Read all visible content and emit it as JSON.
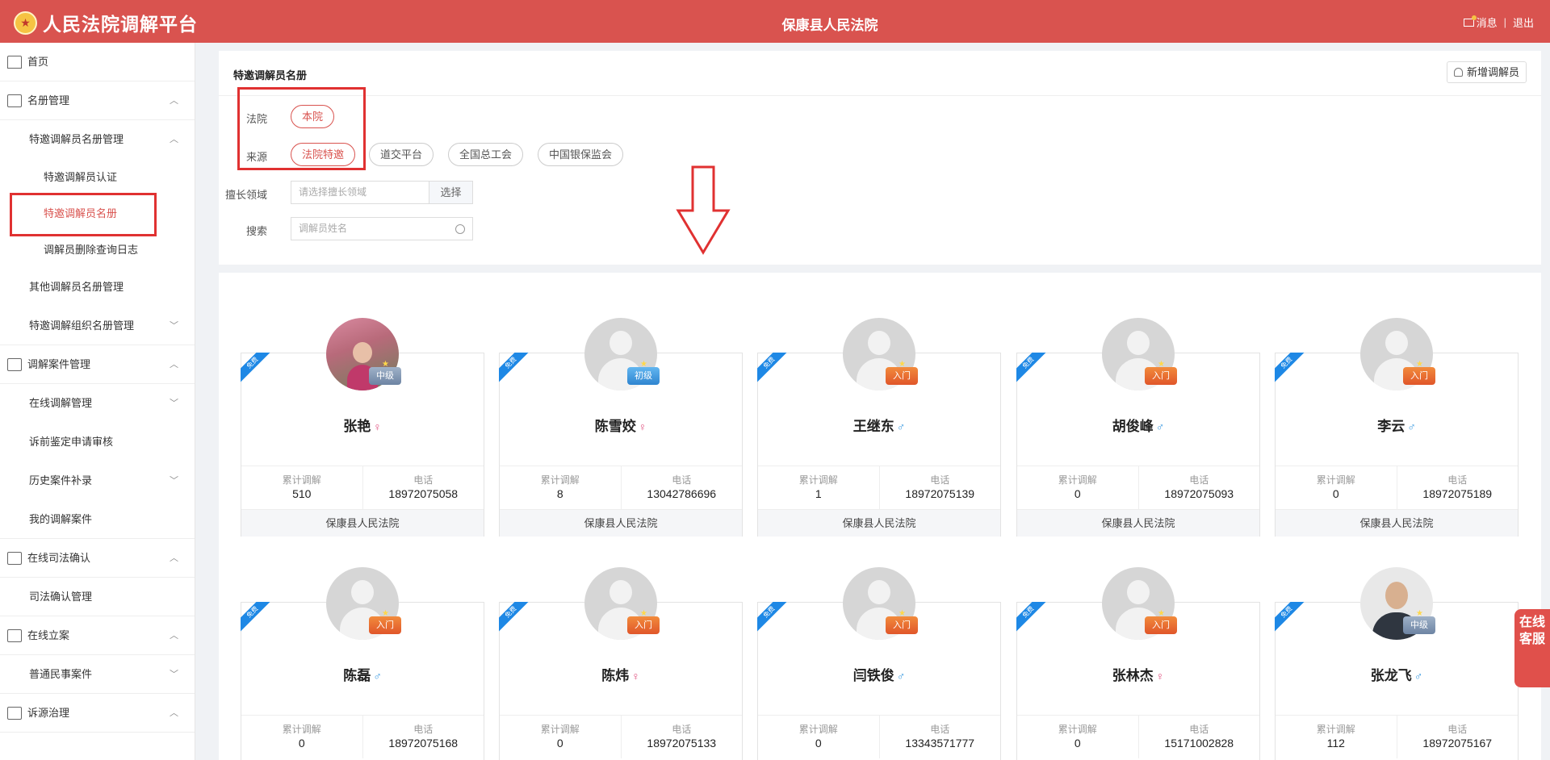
{
  "header": {
    "app_title": "人民法院调解平台",
    "court_name": "保康县人民法院",
    "messages_label": "消息",
    "separator": "|",
    "logout_label": "退出"
  },
  "sidebar": {
    "items": [
      {
        "label": "首页"
      },
      {
        "label": "名册管理"
      },
      {
        "label": "特邀调解员名册管理"
      },
      {
        "label": "特邀调解员认证"
      },
      {
        "label": "特邀调解员名册"
      },
      {
        "label": "调解员删除查询日志"
      },
      {
        "label": "其他调解员名册管理"
      },
      {
        "label": "特邀调解组织名册管理"
      },
      {
        "label": "调解案件管理"
      },
      {
        "label": "在线调解管理"
      },
      {
        "label": "诉前鉴定申请审核"
      },
      {
        "label": "历史案件补录"
      },
      {
        "label": "我的调解案件"
      },
      {
        "label": "在线司法确认"
      },
      {
        "label": "司法确认管理"
      },
      {
        "label": "在线立案"
      },
      {
        "label": "普通民事案件"
      },
      {
        "label": "诉源治理"
      }
    ]
  },
  "filter": {
    "title": "特邀调解员名册",
    "add_button": "新增调解员",
    "court_label": "法院",
    "court_options": [
      "本院"
    ],
    "source_label": "来源",
    "source_options": [
      "法院特邀",
      "道交平台",
      "全国总工会",
      "中国银保监会"
    ],
    "field_label": "擅长领域",
    "field_placeholder": "请选择擅长领域",
    "field_select_button": "选择",
    "search_label": "搜索",
    "search_placeholder": "调解员姓名"
  },
  "card_labels": {
    "ribbon": "免费",
    "cases_label": "累计调解",
    "phone_label": "电话"
  },
  "mediators": [
    {
      "name": "张艳",
      "gender": "♀",
      "level": "中级",
      "cases": "510",
      "phone": "18972075058",
      "court": "保康县人民法院"
    },
    {
      "name": "陈雪姣",
      "gender": "♀",
      "level": "初级",
      "cases": "8",
      "phone": "13042786696",
      "court": "保康县人民法院"
    },
    {
      "name": "王继东",
      "gender": "♂",
      "level": "入门",
      "cases": "1",
      "phone": "18972075139",
      "court": "保康县人民法院"
    },
    {
      "name": "胡俊峰",
      "gender": "♂",
      "level": "入门",
      "cases": "0",
      "phone": "18972075093",
      "court": "保康县人民法院"
    },
    {
      "name": "李云",
      "gender": "♂",
      "level": "入门",
      "cases": "0",
      "phone": "18972075189",
      "court": "保康县人民法院"
    },
    {
      "name": "陈磊",
      "gender": "♂",
      "level": "入门",
      "cases": "0",
      "phone": "18972075168",
      "court": ""
    },
    {
      "name": "陈炜",
      "gender": "♀",
      "level": "入门",
      "cases": "0",
      "phone": "18972075133",
      "court": ""
    },
    {
      "name": "闫铁俊",
      "gender": "♂",
      "level": "入门",
      "cases": "0",
      "phone": "13343571777",
      "court": ""
    },
    {
      "name": "张林杰",
      "gender": "♀",
      "level": "入门",
      "cases": "0",
      "phone": "15171002828",
      "court": ""
    },
    {
      "name": "张龙飞",
      "gender": "♂",
      "level": "中级",
      "cases": "112",
      "phone": "18972075167",
      "court": ""
    }
  ],
  "online_service": "在线客服",
  "colors": {
    "brand": "#d9534f",
    "annotation": "#e03131",
    "ribbon": "#1e88e5"
  }
}
